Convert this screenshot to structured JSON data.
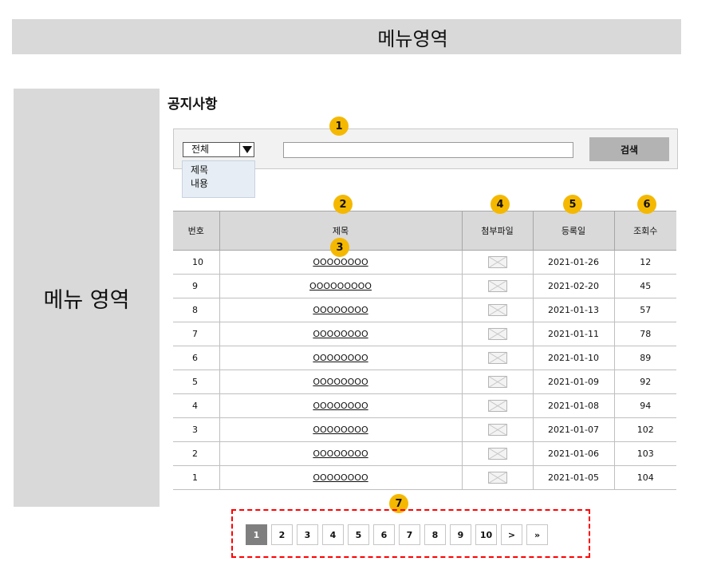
{
  "header": {
    "menu_label": "메뉴영역"
  },
  "sidebar": {
    "menu_label": "메뉴 영역"
  },
  "page_title": "공지사항",
  "search": {
    "select_value": "전체",
    "options": [
      "제목",
      "내용"
    ],
    "input_value": "",
    "button_label": "검색"
  },
  "badges": [
    "1",
    "2",
    "3",
    "4",
    "5",
    "6",
    "7"
  ],
  "table": {
    "headers": {
      "no": "번호",
      "title": "제목",
      "file": "첨부파일",
      "date": "등록일",
      "views": "조회수"
    },
    "rows": [
      {
        "no": "10",
        "title": "OOOOOOOO",
        "date": "2021-01-26",
        "views": "12"
      },
      {
        "no": "9",
        "title": "OOOOOOOOO",
        "date": "2021-02-20",
        "views": "45"
      },
      {
        "no": "8",
        "title": "OOOOOOOO",
        "date": "2021-01-13",
        "views": "57"
      },
      {
        "no": "7",
        "title": "OOOOOOOO",
        "date": "2021-01-11",
        "views": "78"
      },
      {
        "no": "6",
        "title": "OOOOOOOO",
        "date": "2021-01-10",
        "views": "89"
      },
      {
        "no": "5",
        "title": "OOOOOOOO",
        "date": "2021-01-09",
        "views": "92"
      },
      {
        "no": "4",
        "title": "OOOOOOOO",
        "date": "2021-01-08",
        "views": "94"
      },
      {
        "no": "3",
        "title": "OOOOOOOO",
        "date": "2021-01-07",
        "views": "102"
      },
      {
        "no": "2",
        "title": "OOOOOOOO",
        "date": "2021-01-06",
        "views": "103"
      },
      {
        "no": "1",
        "title": "OOOOOOOO",
        "date": "2021-01-05",
        "views": "104"
      }
    ]
  },
  "pagination": {
    "pages": [
      "1",
      "2",
      "3",
      "4",
      "5",
      "6",
      "7",
      "8",
      "9",
      "10"
    ],
    "current": "1",
    "next_label": ">",
    "last_label": "»"
  },
  "colors": {
    "badge": "#f5b800",
    "highlight_border": "#ff0000",
    "menu_bg": "#d9d9d9"
  }
}
